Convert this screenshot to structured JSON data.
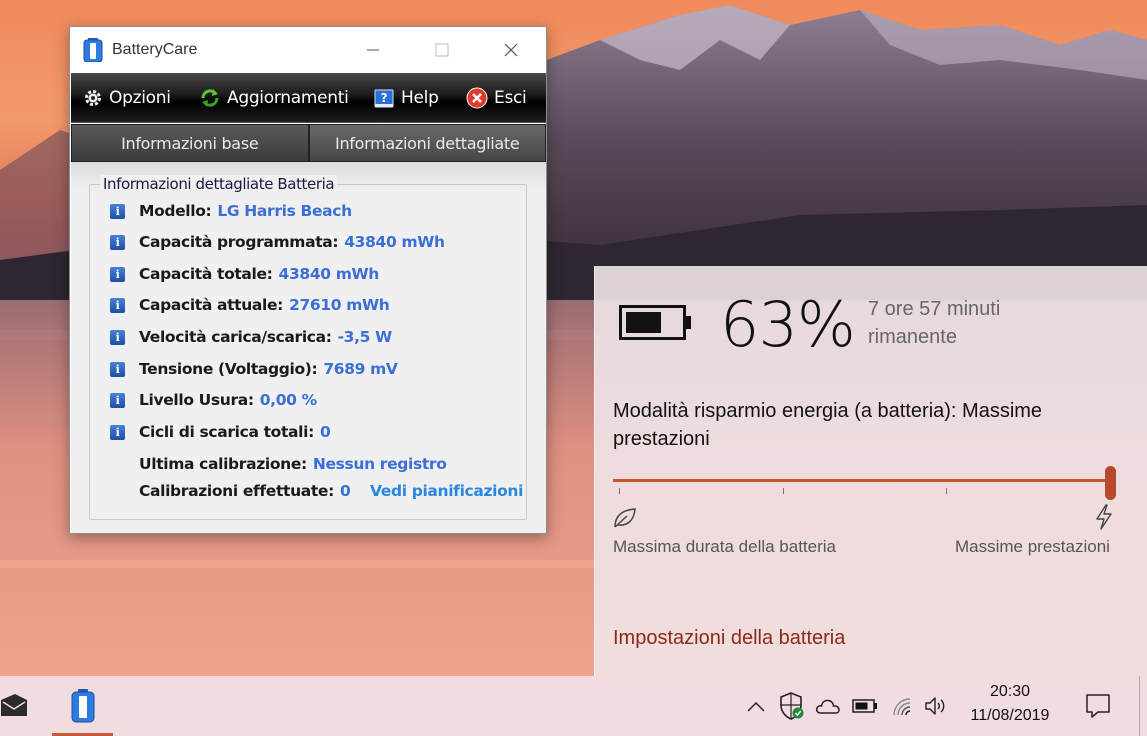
{
  "batterycare": {
    "title": "BatteryCare",
    "menu": {
      "options": "Opzioni",
      "updates": "Aggiornamenti",
      "help": "Help",
      "exit": "Esci"
    },
    "tabs": [
      "Informazioni base",
      "Informazioni dettagliate"
    ],
    "active_tab": "Informazioni dettagliate",
    "group_title": "Informazioni dettagliate Batteria",
    "rows": [
      {
        "label": "Modello:",
        "value": "LG Harris Beach"
      },
      {
        "label": "Capacità programmata:",
        "value": "43840 mWh"
      },
      {
        "label": "Capacità totale:",
        "value": "43840 mWh"
      },
      {
        "label": "Capacità attuale:",
        "value": "27610 mWh"
      },
      {
        "label": "Velocità carica/scarica:",
        "value": "-3,5 W"
      },
      {
        "label": "Tensione (Voltaggio):",
        "value": "7689 mV"
      },
      {
        "label": "Livello Usura:",
        "value": "0,00 %"
      },
      {
        "label": "Cicli di scarica totali:",
        "value": "0"
      }
    ],
    "calibration": {
      "last_label": "Ultima calibrazione:",
      "last_value": "Nessun registro",
      "done_label": "Calibrazioni effettuate:",
      "done_value": "0",
      "schedule_link": "Vedi pianificazioni"
    }
  },
  "flyout": {
    "percent": "63%",
    "level": 0.63,
    "remaining_line1": "7 ore 57 minuti",
    "remaining_line2": "rimanente",
    "mode_text": "Modalità risparmio energia (a batteria): Massime prestazioni",
    "slider_value": 1.0,
    "slider_min_label": "Massima durata della batteria",
    "slider_max_label": "Massime prestazioni",
    "settings_link": "Impostazioni della batteria"
  },
  "taskbar": {
    "time": "20:30",
    "date": "11/08/2019",
    "accent_color": "#c45a3c"
  },
  "colors": {
    "link_blue": "#3b6fd6",
    "flyout_accent": "#c9532e"
  }
}
